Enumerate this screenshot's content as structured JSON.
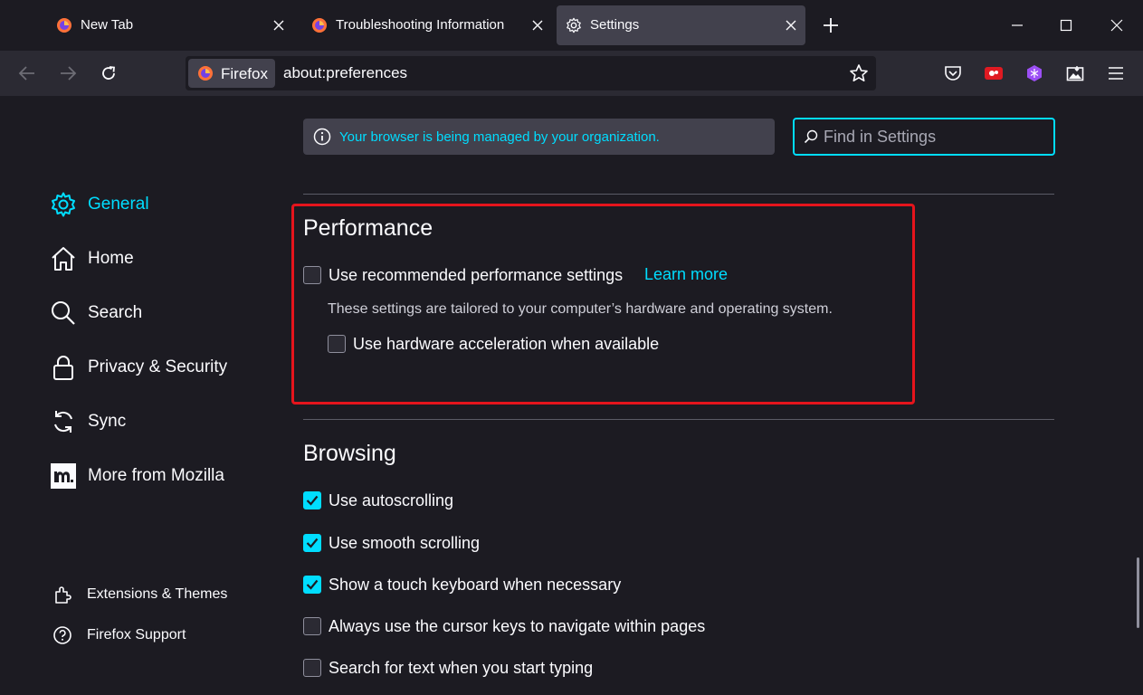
{
  "tabs": [
    {
      "label": "New Tab",
      "icon": "firefox-icon",
      "active": false
    },
    {
      "label": "Troubleshooting Information",
      "icon": "firefox-icon",
      "active": false
    },
    {
      "label": "Settings",
      "icon": "gear-icon",
      "active": true
    }
  ],
  "window_controls": [
    "minimize-icon",
    "maximize-icon",
    "close-icon"
  ],
  "urlbar": {
    "identity_label": "Firefox",
    "url": "about:preferences"
  },
  "toolbar_icons": [
    "pocket-icon",
    "extension-red-icon",
    "extension-purple-icon",
    "screenshot-icon",
    "menu-icon"
  ],
  "policy_notice": "Your browser is being managed by your organization.",
  "search": {
    "placeholder": "Find in Settings"
  },
  "sidebar": {
    "categories": [
      {
        "label": "General",
        "icon": "gear-icon",
        "selected": true
      },
      {
        "label": "Home",
        "icon": "home-icon",
        "selected": false
      },
      {
        "label": "Search",
        "icon": "search-icon",
        "selected": false
      },
      {
        "label": "Privacy & Security",
        "icon": "lock-icon",
        "selected": false
      },
      {
        "label": "Sync",
        "icon": "sync-icon",
        "selected": false
      },
      {
        "label": "More from Mozilla",
        "icon": "mozilla-icon",
        "selected": false
      }
    ],
    "footer": [
      {
        "label": "Extensions & Themes",
        "icon": "puzzle-icon"
      },
      {
        "label": "Firefox Support",
        "icon": "help-icon"
      }
    ]
  },
  "performance": {
    "title": "Performance",
    "recommended_label": "Use recommended performance settings",
    "learn_more": "Learn more",
    "description": "These settings are tailored to your computer’s hardware and operating system.",
    "hw_accel_label": "Use hardware acceleration when available",
    "recommended_checked": false,
    "hw_accel_checked": false
  },
  "browsing": {
    "title": "Browsing",
    "options": [
      {
        "label": "Use autoscrolling",
        "checked": true
      },
      {
        "label": "Use smooth scrolling",
        "checked": true
      },
      {
        "label": "Show a touch keyboard when necessary",
        "checked": true
      },
      {
        "label": "Always use the cursor keys to navigate within pages",
        "checked": false
      },
      {
        "label": "Search for text when you start typing",
        "checked": false
      }
    ]
  },
  "colors": {
    "accent": "#00ddff",
    "highlight_box": "#e5141c",
    "background": "#1c1b22",
    "toolbar": "#2b2a33"
  }
}
